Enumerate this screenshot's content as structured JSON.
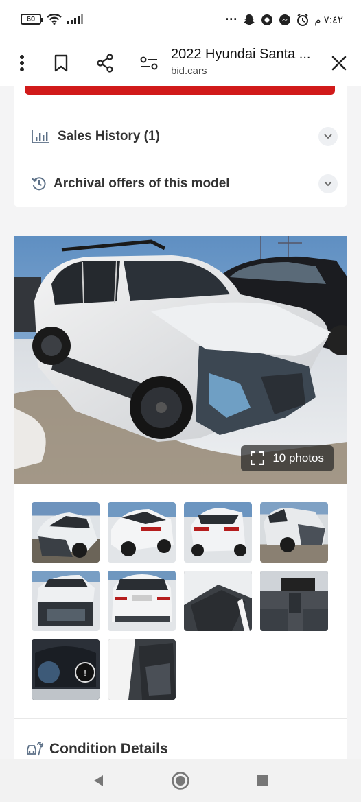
{
  "status_bar": {
    "battery": "60",
    "time": "٧:٤٢ م",
    "dots": "···"
  },
  "app_bar": {
    "title": "2022 Hyundai Santa ...",
    "subtitle": "bid.cars"
  },
  "accordion": [
    {
      "label": "Sales History (1)",
      "icon": "bar-chart-icon"
    },
    {
      "label": "Archival offers of this model",
      "icon": "history-icon"
    }
  ],
  "gallery": {
    "photo_count_label": "10 photos",
    "thumbnails": 10
  },
  "condition": {
    "label": "Condition Details",
    "icon": "car-wrench-icon"
  },
  "colors": {
    "accent_red": "#d11a1a",
    "background": "#f4f4f5"
  }
}
